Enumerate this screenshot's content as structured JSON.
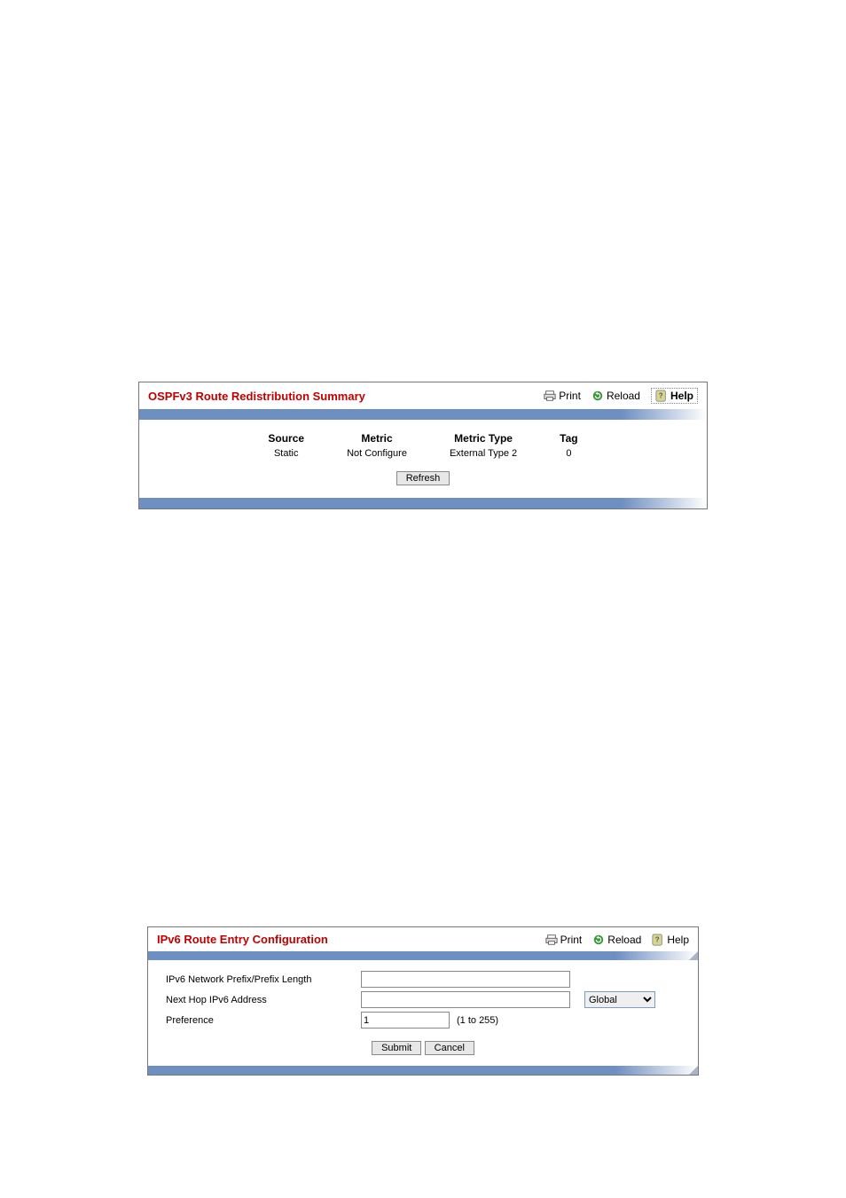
{
  "panel1": {
    "title": "OSPFv3 Route Redistribution Summary",
    "actions": {
      "print": "Print",
      "reload": "Reload",
      "help": "Help"
    },
    "table": {
      "headers": {
        "source": "Source",
        "metric": "Metric",
        "metric_type": "Metric Type",
        "tag": "Tag"
      },
      "row": {
        "source": "Static",
        "metric": "Not Configure",
        "metric_type": "External Type 2",
        "tag": "0"
      }
    },
    "refresh_btn": "Refresh"
  },
  "panel2": {
    "title": "IPv6 Route Entry Configuration",
    "actions": {
      "print": "Print",
      "reload": "Reload",
      "help": "Help"
    },
    "fields": {
      "prefix_label": "IPv6 Network Prefix/Prefix Length",
      "prefix_value": "",
      "nexthop_label": "Next Hop IPv6 Address",
      "nexthop_value": "",
      "nexthop_select": "Global",
      "pref_label": "Preference",
      "pref_value": "1",
      "pref_range": "(1 to 255)"
    },
    "submit_btn": "Submit",
    "cancel_btn": "Cancel"
  }
}
